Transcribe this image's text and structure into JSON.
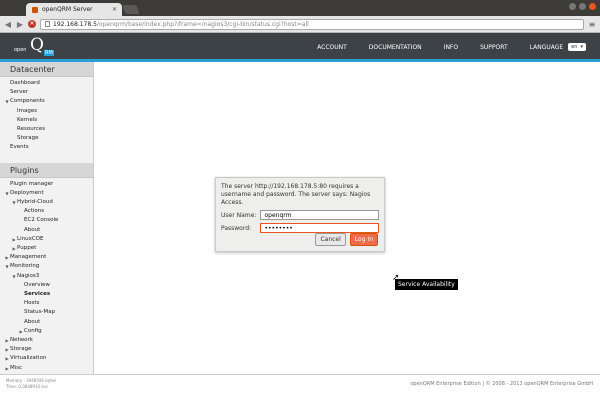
{
  "browser": {
    "tab_title": "openQRM Server",
    "url_host": "192.168.178.5",
    "url_path": "/openqrm/base/index.php?iframe=/nagios3/cgi-bin/status.cgi?host=all"
  },
  "header": {
    "logo_open": "open",
    "logo_q": "Q",
    "logo_em": "RM",
    "nav": [
      "ACCOUNT",
      "DOCUMENTATION",
      "INFO",
      "SUPPORT"
    ],
    "language_label": "LANGUAGE",
    "language_value": "en"
  },
  "sidebar": {
    "datacenter_title": "Datacenter",
    "datacenter_items": [
      {
        "label": "Dashboard",
        "level": 0,
        "arrow": false
      },
      {
        "label": "Server",
        "level": 0,
        "arrow": false
      },
      {
        "label": "Components",
        "level": 0,
        "arrow": "down"
      },
      {
        "label": "Images",
        "level": 1,
        "arrow": false
      },
      {
        "label": "Kernels",
        "level": 1,
        "arrow": false
      },
      {
        "label": "Resources",
        "level": 1,
        "arrow": false
      },
      {
        "label": "Storage",
        "level": 1,
        "arrow": false
      },
      {
        "label": "Events",
        "level": 0,
        "arrow": false
      }
    ],
    "plugins_title": "Plugins",
    "plugin_items": [
      {
        "label": "Plugin manager",
        "level": 0,
        "arrow": false
      },
      {
        "label": "Deployment",
        "level": 0,
        "arrow": "down"
      },
      {
        "label": "Hybrid-Cloud",
        "level": 1,
        "arrow": "down"
      },
      {
        "label": "Actions",
        "level": 2,
        "arrow": false
      },
      {
        "label": "EC2 Console",
        "level": 2,
        "arrow": false
      },
      {
        "label": "About",
        "level": 2,
        "arrow": false
      },
      {
        "label": "LinuxCOE",
        "level": 1,
        "arrow": "right"
      },
      {
        "label": "Puppet",
        "level": 1,
        "arrow": "right"
      },
      {
        "label": "Management",
        "level": 0,
        "arrow": "right"
      },
      {
        "label": "Monitoring",
        "level": 0,
        "arrow": "down"
      },
      {
        "label": "Nagios3",
        "level": 1,
        "arrow": "down"
      },
      {
        "label": "Overview",
        "level": 2,
        "arrow": false
      },
      {
        "label": "Services",
        "level": 2,
        "arrow": false,
        "bold": true
      },
      {
        "label": "Hosts",
        "level": 2,
        "arrow": false
      },
      {
        "label": "Status-Map",
        "level": 2,
        "arrow": false
      },
      {
        "label": "About",
        "level": 2,
        "arrow": false
      },
      {
        "label": "Config",
        "level": 2,
        "arrow": "right"
      },
      {
        "label": "Network",
        "level": 0,
        "arrow": "right"
      },
      {
        "label": "Storage",
        "level": 0,
        "arrow": "right"
      },
      {
        "label": "Virtualization",
        "level": 0,
        "arrow": "right"
      },
      {
        "label": "Misc",
        "level": 0,
        "arrow": "right"
      }
    ]
  },
  "auth_dialog": {
    "message": "The server http://192.168.178.5:80 requires a username and password. The server says: Nagios Access.",
    "username_label": "User Name:",
    "username_value": "openqrm",
    "password_label": "Password:",
    "password_value": "••••••••",
    "cancel_label": "Cancel",
    "login_label": "Log In"
  },
  "tooltip": "Service Availability",
  "footer": {
    "memory": "Memory : 3948596 bytes",
    "time": "Time: 0.0848910 sec",
    "copyright": "openQRM Enterprise Edition | © 2008 - 2013 openQRM Enterprise GmbH"
  }
}
